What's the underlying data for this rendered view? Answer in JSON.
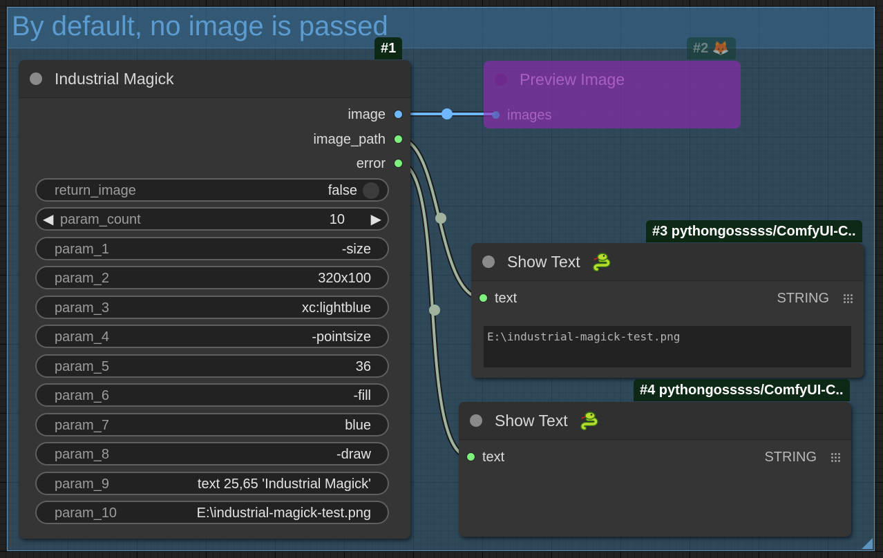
{
  "group": {
    "title": "By default, no image is passed"
  },
  "nodes": {
    "magick": {
      "badge": "#1",
      "title": "Industrial Magick",
      "outputs": [
        {
          "label": "image",
          "color": "#6fb7ff"
        },
        {
          "label": "image_path",
          "color": "#7df07d"
        },
        {
          "label": "error",
          "color": "#7df07d"
        }
      ],
      "return_image": {
        "label": "return_image",
        "value": "false"
      },
      "param_count": {
        "label": "param_count",
        "value": "10"
      },
      "params": [
        {
          "label": "param_1",
          "value": "-size"
        },
        {
          "label": "param_2",
          "value": "320x100"
        },
        {
          "label": "param_3",
          "value": "xc:lightblue"
        },
        {
          "label": "param_4",
          "value": "-pointsize"
        },
        {
          "label": "param_5",
          "value": "36"
        },
        {
          "label": "param_6",
          "value": "-fill"
        },
        {
          "label": "param_7",
          "value": "blue"
        },
        {
          "label": "param_8",
          "value": "-draw"
        },
        {
          "label": "param_9",
          "value": "text 25,65 'Industrial Magick'"
        },
        {
          "label": "param_10",
          "value": "E:\\industrial-magick-test.png"
        }
      ]
    },
    "preview": {
      "badge": "#2 🦊",
      "title": "Preview Image",
      "input": "images"
    },
    "show_text_1": {
      "badge": "#3 pythongosssss/ComfyUI-C..",
      "title": "Show Text",
      "icon": "snake-icon",
      "input": "text",
      "type": "STRING",
      "text": "E:\\industrial-magick-test.png"
    },
    "show_text_2": {
      "badge": "#4 pythongosssss/ComfyUI-C..",
      "title": "Show Text",
      "icon": "snake-icon",
      "input": "text",
      "type": "STRING",
      "text": ""
    }
  },
  "colors": {
    "image_link": "#6fb7ff",
    "string_link": "#9fb39f",
    "group": "#3a6a8a",
    "preview_node": "#9628b4"
  }
}
